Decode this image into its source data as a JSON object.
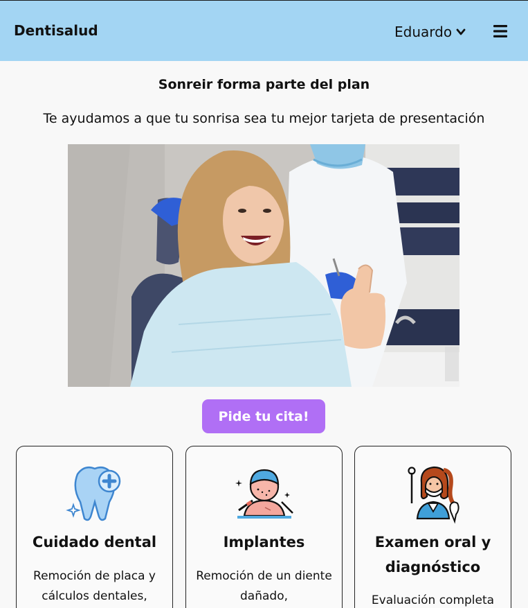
{
  "navbar": {
    "brand": "Dentisalud",
    "user": "Eduardo",
    "user_icon": "chevron-down-icon",
    "menu_icon": "hamburger-menu-icon",
    "background": "#a3d5f3"
  },
  "hero": {
    "title": "Sonreir forma parte del plan",
    "subtitle": "Te ayudamos a que tu sonrisa sea tu mejor tarjeta de presentación",
    "image_icon": "smiling-patient-dental-chair-photo"
  },
  "cta": {
    "label": "Pide tu cita!",
    "color": "#b06ff5"
  },
  "services": [
    {
      "title": "Cuidado dental",
      "description": "Remoción de placa y cálculos dentales,",
      "icon": "tooth-plus-icon"
    },
    {
      "title": "Implantes",
      "description": "Remoción de un diente dañado,",
      "icon": "patient-procedure-icon"
    },
    {
      "title": "Examen oral y diagnóstico",
      "description": "Evaluación completa",
      "icon": "dentist-icon"
    }
  ]
}
